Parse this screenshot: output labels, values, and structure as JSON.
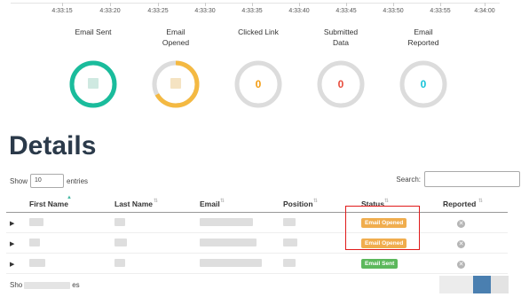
{
  "timeline": {
    "ticks": [
      "4:33:15",
      "4:33:20",
      "4:33:25",
      "4:33:30",
      "4:33:35",
      "4:33:40",
      "4:33:45",
      "4:33:50",
      "4:33:55",
      "4:34:00"
    ]
  },
  "stats": [
    {
      "label": "Email Sent",
      "value": "",
      "color": "#1abc9c",
      "fraction": 1.0
    },
    {
      "label": "Email Opened",
      "value": "",
      "color": "#f4b942",
      "fraction": 0.67
    },
    {
      "label": "Clicked Link",
      "value": "0",
      "color": "#f39c12",
      "fraction": 0
    },
    {
      "label": "Submitted Data",
      "value": "0",
      "color": "#e74c3c",
      "fraction": 0
    },
    {
      "label": "Email Reported",
      "value": "0",
      "color": "#17c3d8",
      "fraction": 0
    }
  ],
  "details": {
    "title": "Details",
    "show_label": "Show",
    "entries_value": "10",
    "entries_label": "entries",
    "search_label": "Search:",
    "search_value": ""
  },
  "table": {
    "columns": [
      "First Name",
      "Last Name",
      "Email",
      "Position",
      "Status",
      "Reported"
    ],
    "rows": [
      {
        "status": "Email Opened",
        "status_type": "opened"
      },
      {
        "status": "Email Opened",
        "status_type": "opened"
      },
      {
        "status": "Email Sent",
        "status_type": "sent"
      }
    ]
  },
  "footer": {
    "info_prefix": "Sho",
    "info_suffix": "es"
  },
  "colors": {
    "highlight": "#e01a1a",
    "opened": "#f0ad4e",
    "sent": "#5cb85c"
  }
}
